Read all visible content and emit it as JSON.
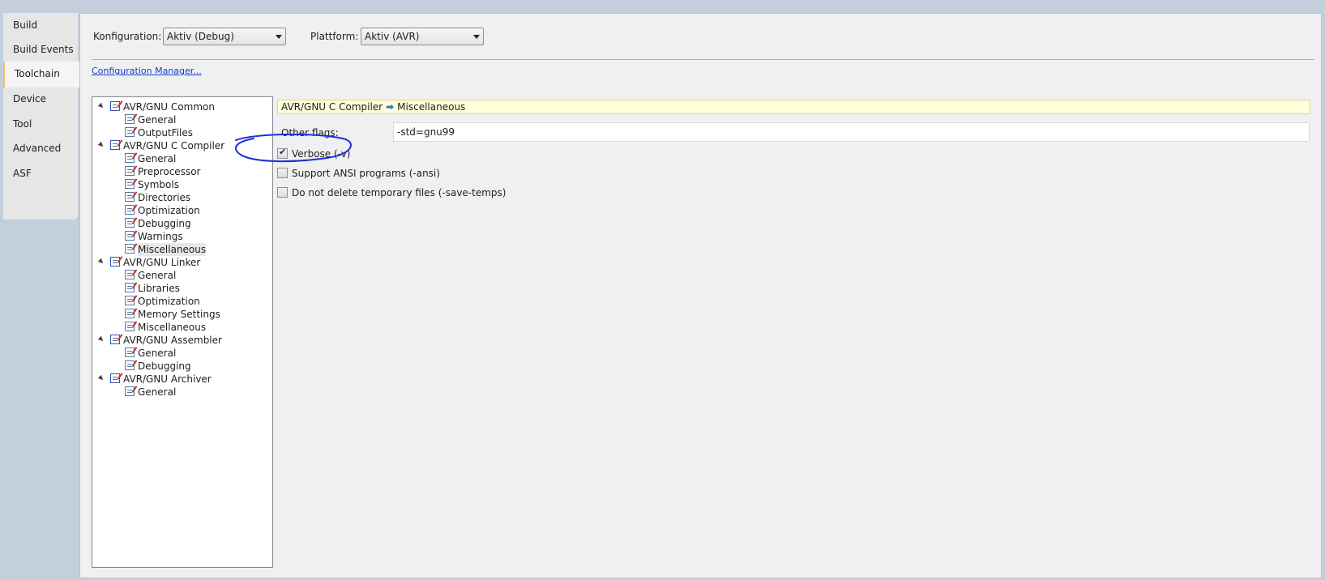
{
  "sidebar": {
    "tabs": [
      {
        "label": "Build"
      },
      {
        "label": "Build Events"
      },
      {
        "label": "Toolchain"
      },
      {
        "label": "Device"
      },
      {
        "label": "Tool"
      },
      {
        "label": "Advanced"
      },
      {
        "label": "ASF"
      }
    ],
    "active": "Toolchain"
  },
  "header": {
    "config_label": "Konfiguration:",
    "config_value": "Aktiv (Debug)",
    "platform_label": "Plattform:",
    "platform_value": "Aktiv (AVR)",
    "config_manager_link": "Configuration Manager..."
  },
  "tree": {
    "groups": [
      {
        "label": "AVR/GNU Common",
        "children": [
          "General",
          "OutputFiles"
        ]
      },
      {
        "label": "AVR/GNU C Compiler",
        "children": [
          "General",
          "Preprocessor",
          "Symbols",
          "Directories",
          "Optimization",
          "Debugging",
          "Warnings",
          "Miscellaneous"
        ]
      },
      {
        "label": "AVR/GNU Linker",
        "children": [
          "General",
          "Libraries",
          "Optimization",
          "Memory Settings",
          "Miscellaneous"
        ]
      },
      {
        "label": "AVR/GNU Assembler",
        "children": [
          "General",
          "Debugging"
        ]
      },
      {
        "label": "AVR/GNU Archiver",
        "children": [
          "General"
        ]
      }
    ],
    "selected": "AVR/GNU C Compiler > Miscellaneous"
  },
  "content": {
    "breadcrumb_parent": "AVR/GNU C Compiler",
    "breadcrumb_child": "Miscellaneous",
    "other_flags_label": "Other flags:",
    "other_flags_value": "-std=gnu99",
    "options": [
      {
        "label": "Verbose (-v)",
        "checked": true
      },
      {
        "label": "Support ANSI programs (-ansi)",
        "checked": false
      },
      {
        "label": "Do not delete temporary files (-save-temps)",
        "checked": false
      }
    ]
  },
  "colors": {
    "annotation_circle": "#1a2fd8",
    "breadcrumb_bg": "#ffffd9",
    "active_tab_accent": "#f0c068"
  }
}
